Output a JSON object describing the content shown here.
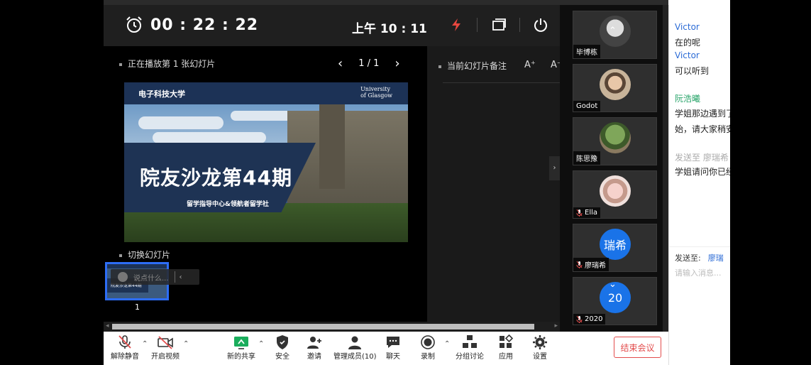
{
  "topbar": {
    "timer": "00 : 22 : 22",
    "current_time": "上午 10 : 11"
  },
  "slides": {
    "playing_label": "正在播放第 1 张幻灯片",
    "page": "1 / 1",
    "prev": "‹",
    "next": "›",
    "switch_label": "切换幻灯片",
    "thumb_number": "1",
    "slide_title": "院友沙龙第44期",
    "slide_subtitle": "留学指导中心&领航者留学社",
    "slide_logo": "电子科技大学",
    "slide_uni": "University\nof Glasgow",
    "thumb_title": "院友沙龙第44期",
    "chat_placeholder": "说点什么..."
  },
  "notes": {
    "label": "当前幻灯片备注",
    "font_up": "A⁺",
    "font_down": "A⁻"
  },
  "participants": [
    {
      "name": "毕博栋",
      "avatar": "photo-dark",
      "muted": false
    },
    {
      "name": "Godot",
      "avatar": "photo-cartoon",
      "muted": false
    },
    {
      "name": "陈思豫",
      "avatar": "photo-tree",
      "muted": false
    },
    {
      "name": "Ella",
      "avatar": "photo-girl",
      "muted": true
    },
    {
      "name": "廖瑞希",
      "avatar_text": "瑞希",
      "muted": true
    },
    {
      "name": "2020",
      "avatar_text": "20",
      "muted": true
    }
  ],
  "chat": {
    "messages": [
      {
        "sender": "Victor",
        "text": "在的呢"
      },
      {
        "sender": "Victor",
        "text": "可以听到"
      },
      {
        "sender": "阮浩曦",
        "text": "学姐那边遇到了",
        "text2": "始，请大家稍安"
      },
      {
        "sender": "发送至  廖瑞希",
        "text": "学姐请问你已经"
      }
    ],
    "send_to_label": "发送至:",
    "send_to_recipient": "廖瑞",
    "input_placeholder": "请输入消息..."
  },
  "toolbar": {
    "unmute": "解除静音",
    "start_video": "开启视频",
    "new_share": "新的共享",
    "security": "安全",
    "invite": "邀请",
    "manage_members": "管理成员(10)",
    "chat": "聊天",
    "record": "录制",
    "breakout": "分组讨论",
    "apps": "应用",
    "settings": "设置",
    "end_meeting": "结束会议"
  },
  "colors": {
    "accent": "#2d6df6",
    "end_red": "#e34d4d",
    "share_green": "#1aad5c",
    "flash_red": "#e8473f"
  }
}
